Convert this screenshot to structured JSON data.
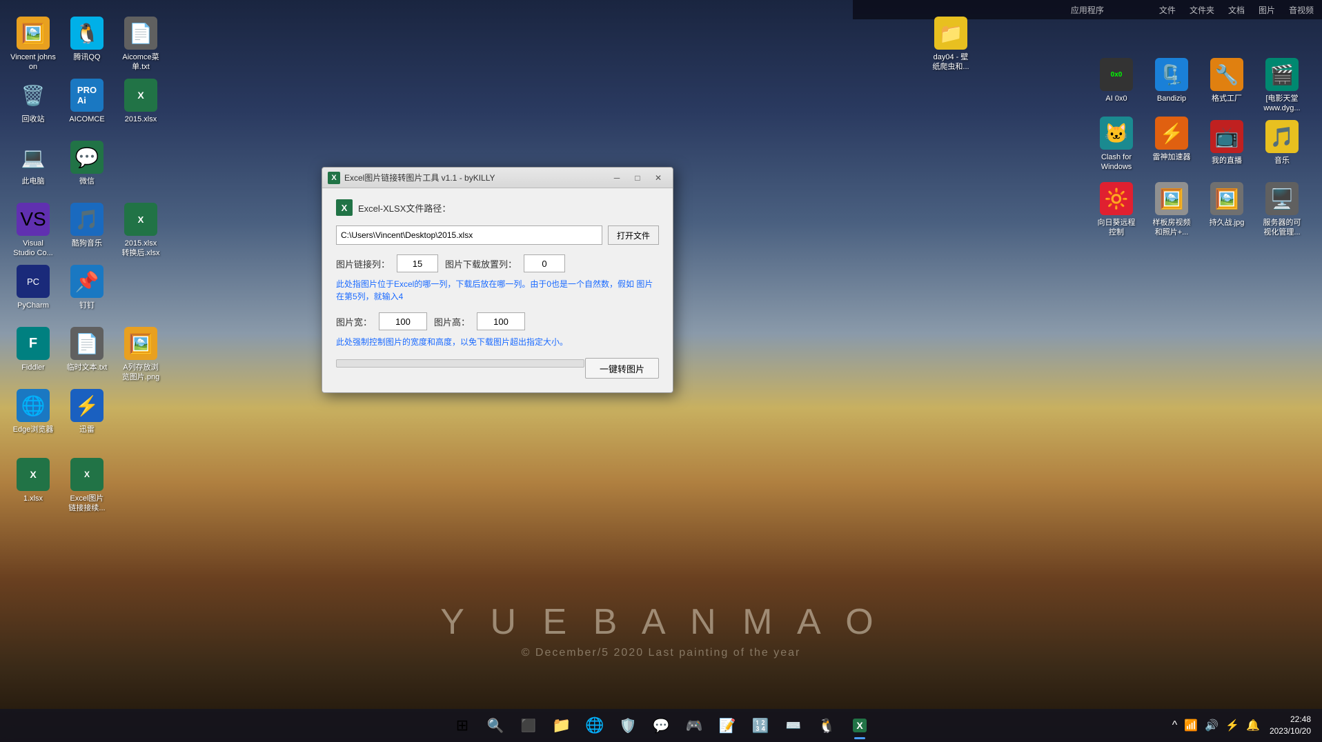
{
  "desktop": {
    "background": "anime city night scene",
    "watermark": {
      "main": "Y U E B A N M A O",
      "sub": "© December/5 2020  Last painting of the year"
    }
  },
  "top_bar": {
    "items": [
      "应用程序",
      "文件夹",
      "文档",
      "图片",
      "音视频",
      "文件"
    ]
  },
  "left_icons": [
    {
      "id": "vincent-johnson",
      "label": "Vincent\njohnson",
      "emoji": "🖼️",
      "color": "ico-orange"
    },
    {
      "id": "qq",
      "label": "腾讯QQ",
      "emoji": "🐧",
      "color": "ico-cyan"
    },
    {
      "id": "aicomce-menu",
      "label": "Aicomce菜\n单.txt",
      "emoji": "📄",
      "color": "ico-gray"
    },
    {
      "id": "recycle-bin",
      "label": "回收站",
      "emoji": "🗑️",
      "color": "ico-gray"
    },
    {
      "id": "aicomce",
      "label": "AICOMCE",
      "emoji": "🤖",
      "color": "ico-blue"
    },
    {
      "id": "excel-2015",
      "label": "2015.xlsx",
      "emoji": "📊",
      "color": "ico-green"
    },
    {
      "id": "this-pc",
      "label": "此电脑",
      "emoji": "💻",
      "color": "ico-blue"
    },
    {
      "id": "wechat",
      "label": "微信",
      "emoji": "💬",
      "color": "ico-green"
    },
    {
      "id": "visual-studio",
      "label": "Visual\nStudio Co...",
      "emoji": "🔷",
      "color": "ico-purple"
    },
    {
      "id": "kuwo",
      "label": "酷狗音乐",
      "emoji": "🎵",
      "color": "ico-blue"
    },
    {
      "id": "excel-convert",
      "label": "2015.xlsx\n转换后.xlsx",
      "emoji": "📊",
      "color": "ico-green"
    },
    {
      "id": "pycharm",
      "label": "PyCharm",
      "emoji": "🐍",
      "color": "ico-darkblue"
    },
    {
      "id": "dingtalk",
      "label": "钉钉",
      "emoji": "📌",
      "color": "ico-blue"
    },
    {
      "id": "fiddler",
      "label": "Fiddler",
      "emoji": "F",
      "color": "ico-teal"
    },
    {
      "id": "temp-txt",
      "label": "临时文本.txt",
      "emoji": "📄",
      "color": "ico-gray"
    },
    {
      "id": "a-column-img",
      "label": "A列存放浏\n览图片.png",
      "emoji": "🖼️",
      "color": "ico-orange"
    },
    {
      "id": "edge",
      "label": "Edge浏览器",
      "emoji": "🌐",
      "color": "ico-blue"
    },
    {
      "id": "xunlei",
      "label": "迅雷",
      "emoji": "⚡",
      "color": "ico-blue"
    },
    {
      "id": "excel-1",
      "label": "1.xlsx",
      "emoji": "📊",
      "color": "ico-green"
    },
    {
      "id": "excel-img-tool",
      "label": "Excel图片\n链接接续...",
      "emoji": "📊",
      "color": "ico-green"
    }
  ],
  "right_icons": [
    {
      "id": "day04",
      "label": "day04 - 壁\n纸爬虫和...",
      "emoji": "📁",
      "color": "ico-yellow"
    },
    {
      "id": "ai0x0",
      "label": "AI 0x0",
      "emoji": "0x0",
      "color": "ico-gray"
    },
    {
      "id": "bandizip",
      "label": "Bandizip",
      "emoji": "🗜️",
      "color": "ico-blue"
    },
    {
      "id": "format-factory",
      "label": "格式工厂",
      "emoji": "🔧",
      "color": "ico-orange"
    },
    {
      "id": "movie-heaven",
      "label": "[电影天堂\nwww.dyg...",
      "emoji": "🎬",
      "color": "ico-teal"
    },
    {
      "id": "my-live",
      "label": "我的直播",
      "emoji": "📺",
      "color": "ico-red"
    },
    {
      "id": "music",
      "label": "音乐",
      "emoji": "🎵",
      "color": "ico-yellow"
    },
    {
      "id": "clash-windows",
      "label": "Clash for\nWindows",
      "emoji": "🐱",
      "color": "ico-teal"
    },
    {
      "id": "thunder-acc",
      "label": "雷神加速器",
      "emoji": "⚡",
      "color": "ico-orange"
    },
    {
      "id": "remote-ctrl",
      "label": "向日葵远程\n控制",
      "emoji": "🔆",
      "color": "ico-red"
    },
    {
      "id": "sample-video",
      "label": "样板房视频\n和照片+...",
      "emoji": "🖼️",
      "color": "ico-gray"
    },
    {
      "id": "yijuzhan-jpg",
      "label": "持久战.jpg",
      "emoji": "🖼️",
      "color": "ico-gray"
    },
    {
      "id": "server-mgmt",
      "label": "服务器的可\n视化管理...",
      "emoji": "🖥️",
      "color": "ico-gray"
    }
  ],
  "taskbar": {
    "apps": [
      {
        "id": "start",
        "emoji": "⊞",
        "label": "开始"
      },
      {
        "id": "search",
        "emoji": "🔍",
        "label": "搜索"
      },
      {
        "id": "task-view",
        "emoji": "⬛",
        "label": "任务视图"
      },
      {
        "id": "file-explorer",
        "emoji": "📁",
        "label": "文件资源管理器"
      },
      {
        "id": "edge-browser",
        "emoji": "🌐",
        "label": "Microsoft Edge"
      },
      {
        "id": "360",
        "emoji": "🛡️",
        "label": "360"
      },
      {
        "id": "wechat-task",
        "emoji": "💬",
        "label": "微信"
      },
      {
        "id": "game",
        "emoji": "🎮",
        "label": "游戏"
      },
      {
        "id": "notepad",
        "emoji": "📝",
        "label": "记事本"
      },
      {
        "id": "calculator",
        "emoji": "🔢",
        "label": "计算器"
      },
      {
        "id": "input-method",
        "emoji": "⌨️",
        "label": "输入法"
      },
      {
        "id": "qq-task",
        "emoji": "🐧",
        "label": "QQ"
      },
      {
        "id": "excel-task",
        "emoji": "📊",
        "label": "Excel",
        "active": true
      }
    ],
    "tray": {
      "icons": [
        "^",
        "🔊",
        "📶",
        "⚡",
        "🔔"
      ],
      "time": "22:48",
      "date": "2023/10/20"
    }
  },
  "dialog": {
    "title": "Excel图片链接转图片工具 v1.1 - byKILLY",
    "title_icon": "X",
    "section_label": "Excel-XLSX文件路径：",
    "file_path": "C:\\Users\\Vincent\\Desktop\\2015.xlsx",
    "open_btn_label": "打开文件",
    "fields": [
      {
        "label": "图片链接列：",
        "value": "15"
      },
      {
        "label": "图片下载放置列：",
        "value": "0"
      }
    ],
    "info_text1": "此处指图片位于Excel的哪一列，下载后放在哪一列。由于0也是一个自然数，假如\n图片在第5列，就输入4",
    "size_fields": [
      {
        "label": "图片宽：",
        "value": "100"
      },
      {
        "label": "图片高：",
        "value": "100"
      }
    ],
    "info_text2": "此处强制控制图片的宽度和高度，以免下载图片超出指定大小。",
    "action_btn_label": "一键转图片",
    "progress": 0
  }
}
